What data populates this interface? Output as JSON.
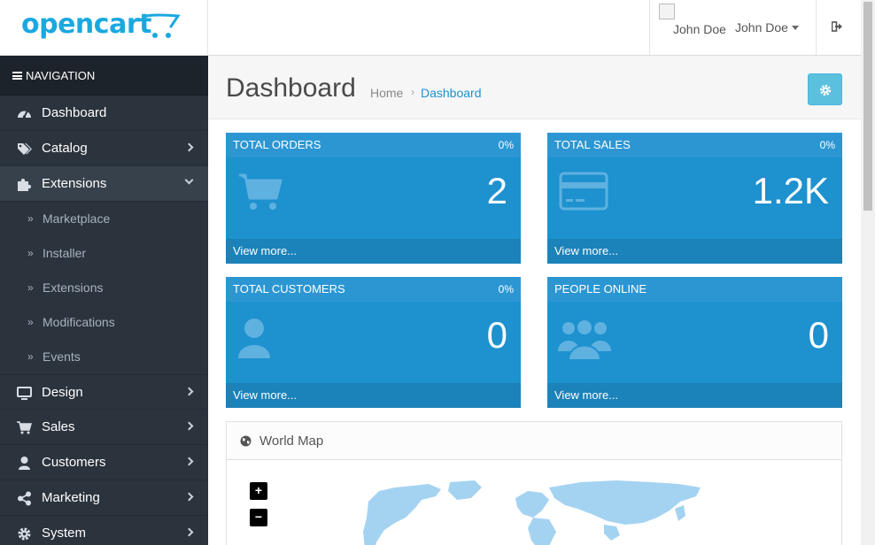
{
  "app": {
    "brand": "opencart"
  },
  "header": {
    "user_name": "John Doe",
    "user_dropdown": "John Doe"
  },
  "sidebar": {
    "title": "NAVIGATION",
    "items": [
      {
        "label": "Dashboard",
        "icon": "dashboard-icon"
      },
      {
        "label": "Catalog",
        "icon": "tags-icon"
      },
      {
        "label": "Extensions",
        "icon": "puzzle-icon"
      },
      {
        "label": "Design",
        "icon": "monitor-icon"
      },
      {
        "label": "Sales",
        "icon": "cart-icon"
      },
      {
        "label": "Customers",
        "icon": "user-icon"
      },
      {
        "label": "Marketing",
        "icon": "share-icon"
      },
      {
        "label": "System",
        "icon": "gear-icon"
      }
    ],
    "sub_items": [
      "Marketplace",
      "Installer",
      "Extensions",
      "Modifications",
      "Events"
    ]
  },
  "page": {
    "title": "Dashboard",
    "breadcrumb": [
      "Home",
      "Dashboard"
    ]
  },
  "tiles": [
    {
      "title": "TOTAL ORDERS",
      "pct": "0%",
      "value": "2",
      "link": "View more...",
      "icon": "cart-icon"
    },
    {
      "title": "TOTAL SALES",
      "pct": "0%",
      "value": "1.2K",
      "link": "View more...",
      "icon": "credit-card-icon"
    },
    {
      "title": "TOTAL CUSTOMERS",
      "pct": "0%",
      "value": "0",
      "link": "View more...",
      "icon": "user-icon"
    },
    {
      "title": "PEOPLE ONLINE",
      "pct": "",
      "value": "0",
      "link": "View more...",
      "icon": "users-icon"
    }
  ],
  "map": {
    "title": "World Map",
    "zoom_in": "+",
    "zoom_out": "−"
  },
  "colors": {
    "accent": "#1e91cf",
    "sidebar": "#2b333d",
    "button": "#5bc0de"
  }
}
